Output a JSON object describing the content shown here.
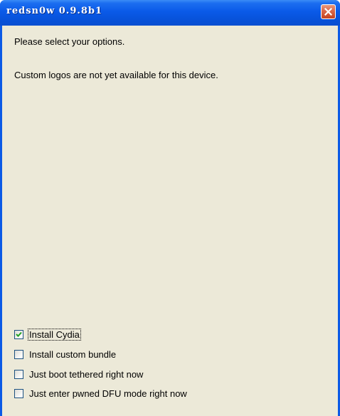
{
  "window": {
    "title": "redsn0w 0.9.8b1",
    "close_icon": "close-icon"
  },
  "messages": {
    "select_options": "Please select your options.",
    "logos_unavailable": "Custom logos are not yet available for this device."
  },
  "options": [
    {
      "label": "Install Cydia",
      "checked": true
    },
    {
      "label": "Install custom bundle",
      "checked": false
    },
    {
      "label": "Just boot tethered right now",
      "checked": false
    },
    {
      "label": "Just enter pwned DFU mode right now",
      "checked": false
    }
  ],
  "colors": {
    "titlebar": "#0a5ae8",
    "client_background": "#ece9d8",
    "close_button": "#dc6a4b"
  }
}
